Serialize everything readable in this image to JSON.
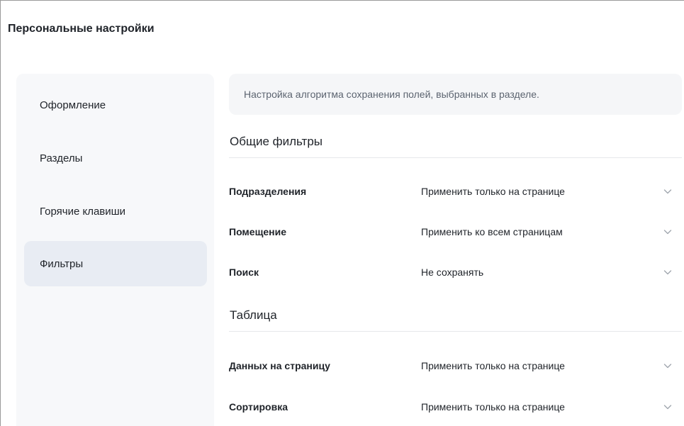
{
  "page": {
    "title": "Персональные настройки"
  },
  "sidebar": {
    "items": [
      {
        "label": "Оформление",
        "active": false
      },
      {
        "label": "Разделы",
        "active": false
      },
      {
        "label": "Горячие клавиши",
        "active": false
      },
      {
        "label": "Фильтры",
        "active": true
      }
    ]
  },
  "content": {
    "info_text": "Настройка алгоритма сохранения полей, выбранных в разделе.",
    "sections": [
      {
        "title": "Общие фильтры",
        "rows": [
          {
            "label": "Подразделения",
            "value": "Применить только на странице",
            "icon": "chevron-down-icon"
          },
          {
            "label": "Помещение",
            "value": "Применить ко всем страницам",
            "icon": "chevron-down-icon"
          },
          {
            "label": "Поиск",
            "value": "Не сохранять",
            "icon": "chevron-down-icon"
          }
        ]
      },
      {
        "title": "Таблица",
        "rows": [
          {
            "label": "Данных на страницу",
            "value": "Применить только на странице",
            "icon": "chevron-down-icon"
          },
          {
            "label": "Сортировка",
            "value": "Применить только на странице",
            "icon": "chevron-down-icon"
          }
        ]
      }
    ]
  },
  "colors": {
    "active_nav_bg": "#e8ecf3",
    "sidebar_bg": "#f7f8fa",
    "info_bg": "#f5f6f8",
    "chevron": "#a0a6ae"
  }
}
